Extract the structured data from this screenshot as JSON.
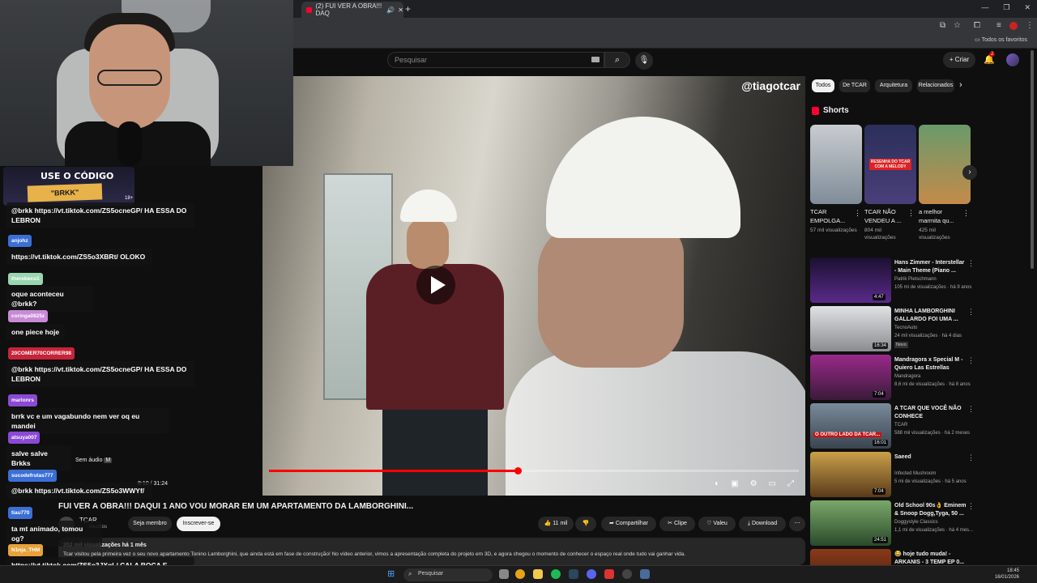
{
  "browser": {
    "tab_title": "(2) FUI VER A OBRA!!! DAQ",
    "bookmarks_label": "Todos os favoritos"
  },
  "youtube": {
    "search_placeholder": "Pesquisar",
    "create_label": "Criar",
    "notifications_count": "2",
    "chips": [
      "Todos",
      "De TCAR",
      "Arquitetura",
      "Relacionados"
    ],
    "shorts_title": "Shorts",
    "shorts": [
      {
        "title": "TCAR EMPOLGA...",
        "views": "57 mil visualizações",
        "color": "#8c9aa6"
      },
      {
        "title": "TCAR NÃO VENDEU A ...",
        "views": "804 mil visualizações",
        "color": "#3a3f72",
        "thumb_text": "RESENHA DO TCAR COM A MELODY"
      },
      {
        "title": "a melhor marmita qu...",
        "views": "425 mil visualizações",
        "color": "#8a5a2e"
      }
    ],
    "recommendations": [
      {
        "title": "Hans Zimmer - Interstellar - Main Theme (Piano ...",
        "channel": "Patrik Pietschmann",
        "meta": "105 mi de visualizações · há 9 anos",
        "duration": "4:47",
        "color": "#3a1f5e",
        "badge": ""
      },
      {
        "title": "MINHA LAMBORGHINI GALLARDO FOI UMA ...",
        "channel": "TecnoAuto",
        "meta": "24 mil visualizações · há 4 dias",
        "duration": "16:34",
        "color": "#c7c9cc",
        "badge": "Novo"
      },
      {
        "title": "Mandragora x Special M - Quiero Las Estrellas",
        "channel": "Mandragora",
        "meta": "8,6 mi de visualizações · há 8 anos",
        "duration": "7:04",
        "color": "#7a2a66",
        "badge": ""
      },
      {
        "title": "A TCAR QUE VOCÊ NÃO CONHECE",
        "channel": "TCAR",
        "meta": "588 mil visualizações · há 2 meses",
        "duration": "16:01",
        "color": "#4a5866",
        "badge": "",
        "thumb_text": "O OUTRO LADO DA TCAR..."
      },
      {
        "title": "Saeed",
        "channel": "Infected Mushroom",
        "meta": "5 mi de visualizações · há 5 anos",
        "duration": "7:04",
        "color": "#8a6a2a",
        "badge": ""
      },
      {
        "title": "Old School 90s👌 Eminem & Snoop Dogg,Tyga, 50 ...",
        "channel": "Doggystyle Classics",
        "meta": "1,1 mi de visualizações · há 4 mes...",
        "duration": "24:51",
        "color": "#3f6a3a",
        "badge": ""
      },
      {
        "title": "😂 hoje tudo muda! - ARKANIS - 3 TEMP EP 0...",
        "channel": "",
        "meta": "",
        "duration": "",
        "color": "#6a2a1a",
        "badge": ""
      }
    ]
  },
  "video": {
    "watermark": "@tiagotcar",
    "sem_audio": "Sem áudio",
    "sem_audio_key": "M",
    "timecode": "8:10 / 31:24",
    "progress": 0.47,
    "title": "FUI VER A OBRA!!! DAQUI 1 ANO VOU MORAR EM UM APARTAMENTO DA LAMBORGHINI...",
    "channel": "TCAR",
    "subscribers": "inscritos",
    "join_label": "Seja membro",
    "subscribe_label": "Inscrever-se",
    "likes": "11 mil",
    "share_label": "Compartilhar",
    "clip_label": "Clipe",
    "thanks_label": "Valeu",
    "download_label": "Download",
    "desc_meta": "352 mil visualizações  há 1 mês",
    "desc_text": "Tcar visitou pela primeira vez o seu novo apartamento Tonino Lamborghini, que ainda está em fase de construção! No vídeo anterior, vimos a apresentação completa do projeto em 3D, e agora chegou o momento de conhecer o espaço real onde tudo vai ganhar vida."
  },
  "stream": {
    "promo_title": "USE O CÓDIGO",
    "promo_code": "\"BRKK\"",
    "promo_age": "18+",
    "chat": [
      {
        "name": "",
        "text": "@brkk https://vt.tiktok.com/ZS5ocneGP/ HA ESSA DO LEBRON",
        "color": ""
      },
      {
        "name": "anjohz",
        "text": "https://vt.tiktok.com/ZS5o3XBRt/ OLOKO",
        "color": "#3b6fd6"
      },
      {
        "name": "therebeco1",
        "text": "oque aconteceu @brkk?",
        "color": "#9ad6b0"
      },
      {
        "name": "coringa0825z",
        "text": "one piece hoje",
        "color": "#c88ad6"
      },
      {
        "name": "20COMER70CORRER98",
        "text": "@brkk https://vt.tiktok.com/ZS5ocneGP/ HA ESSA DO LEBRON",
        "color": "#c8233a"
      },
      {
        "name": "marlonrs",
        "text": "brrk vc e um vagabundo nem ver oq eu mandei",
        "color": "#8a4ad6"
      },
      {
        "name": "atsuya007",
        "text": "salve salve Brkks",
        "color": "#8a4ad6"
      },
      {
        "name": "sucodefrutas777",
        "text": "@brkk https://vt.tiktok.com/ZS5o3WWYf/",
        "color": "#3b6fd6"
      },
      {
        "name": "tiau770",
        "text": "ta mt animado, tomou og?",
        "color": "#3b6fd6"
      },
      {
        "name": "N1nja_THM",
        "text": "https://vt.tiktok.com/ZS5o3JXqL/ CALA BOCA E ESCULTA ISSO @brkk",
        "color": "#e8a23a"
      }
    ]
  },
  "taskbar": {
    "search_label": "Pesquisar",
    "time": "18:45",
    "date": "16/01/2026"
  }
}
